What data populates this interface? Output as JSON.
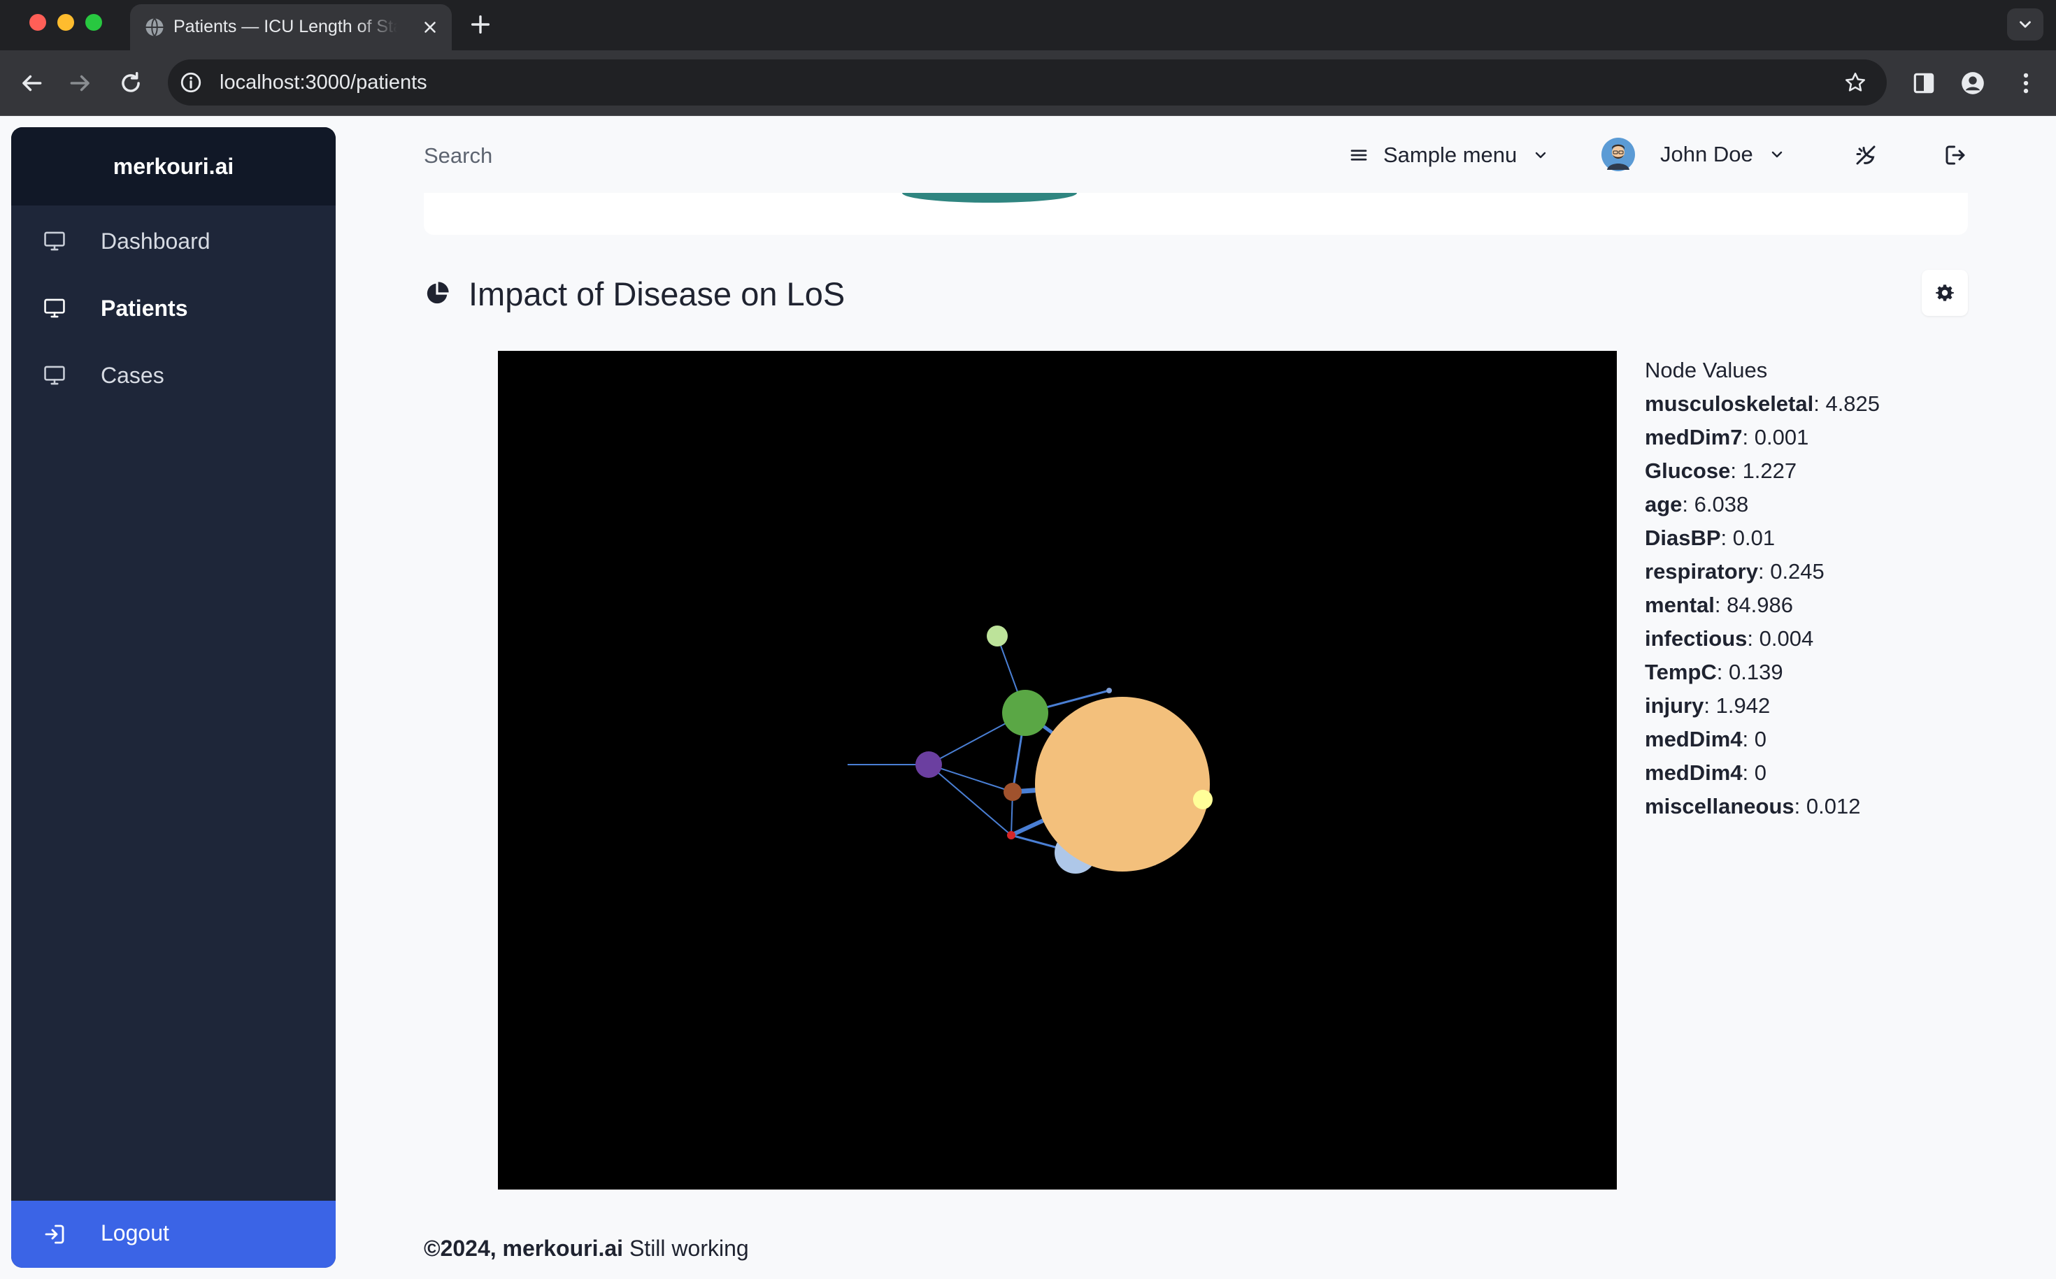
{
  "browser": {
    "tab_title": "Patients — ICU Length of Stay",
    "url": "localhost:3000/patients"
  },
  "sidebar": {
    "brand": "merkouri.ai",
    "items": [
      {
        "label": "Dashboard",
        "icon": "monitor-icon",
        "active": false
      },
      {
        "label": "Patients",
        "icon": "monitor-icon",
        "active": true
      },
      {
        "label": "Cases",
        "icon": "monitor-icon",
        "active": false
      }
    ],
    "logout_label": "Logout"
  },
  "header": {
    "search_placeholder": "Search",
    "menu_label": "Sample menu",
    "user_name": "John Doe"
  },
  "section": {
    "title": "Impact of Disease on LoS",
    "icon": "pie-chart-icon"
  },
  "node_values": {
    "heading": "Node Values",
    "items": [
      {
        "name": "musculoskeletal",
        "value": "4.825"
      },
      {
        "name": "medDim7",
        "value": "0.001"
      },
      {
        "name": "Glucose",
        "value": "1.227"
      },
      {
        "name": "age",
        "value": "6.038"
      },
      {
        "name": "DiasBP",
        "value": "0.01"
      },
      {
        "name": "respiratory",
        "value": "0.245"
      },
      {
        "name": "mental",
        "value": "84.986"
      },
      {
        "name": "infectious",
        "value": "0.004"
      },
      {
        "name": "TempC",
        "value": "0.139"
      },
      {
        "name": "injury",
        "value": "1.942"
      },
      {
        "name": "medDim4",
        "value": "0"
      },
      {
        "name": "medDim4",
        "value": "0"
      },
      {
        "name": "miscellaneous",
        "value": "0.012"
      }
    ]
  },
  "graph": {
    "background": "#000000",
    "link_color": "#4a7fd4",
    "node_colors": [
      "#f3c07c",
      "#5aa745",
      "#bde39a",
      "#6b3fa0",
      "#a0522d",
      "#d62728",
      "#aec7e8",
      "#ffff99",
      "#7f9fd8"
    ]
  },
  "footer": {
    "copyright": "©2024, merkouri.ai",
    "status": "Still working"
  },
  "colors": {
    "sidebar_bg": "#1e2639",
    "brand_bg": "#111827",
    "accent": "#3b64e6"
  }
}
